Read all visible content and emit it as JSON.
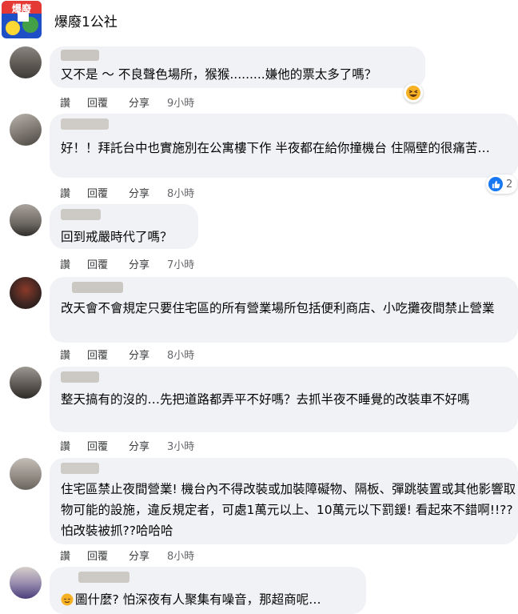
{
  "page": {
    "name": "爆廢1公社",
    "logo_text": "爆廢"
  },
  "actions": {
    "like": "讚",
    "reply": "回覆",
    "share": "分享"
  },
  "comments": [
    {
      "text": "又不是 ～ 不良聲色場所，猴猴.........嫌他的票太多了嗎？",
      "time": "9小時",
      "reaction": "laughing-emoji"
    },
    {
      "text": "好！！拜託台中也實施別在公寓樓下作 半夜都在給你撞機台 住隔壁的很痛苦…",
      "time": "8小時",
      "like_count": "2"
    },
    {
      "text": "回到戒嚴時代了嗎？",
      "time": "7小時"
    },
    {
      "text": "改天會不會規定只要住宅區的所有營業場所包括便利商店、小吃攤夜間禁止營業",
      "time": "8小時"
    },
    {
      "text": "整天搞有的沒的…先把道路都弄平不好嗎？去抓半夜不睡覺的改裝車不好嗎",
      "time": "3小時"
    },
    {
      "text": "住宅區禁止夜間營業! 機台內不得改裝或加裝障礙物、隔板、彈跳裝置或其他影響取物可能的設施，違反規定者，可處1萬元以上、10萬元以下罰鍰! 看起來不錯啊!!?? 怕改裝被抓??哈哈哈",
      "time": "8小時"
    },
    {
      "text": "圖什麼? 怕深夜有人聚集有噪音，那超商呢…",
      "emoji": "relieved-face-emoji"
    }
  ],
  "colors": {
    "bubble": "#f0f2f5",
    "like_blue": "#1877f2",
    "meta_gray": "#65676b"
  }
}
